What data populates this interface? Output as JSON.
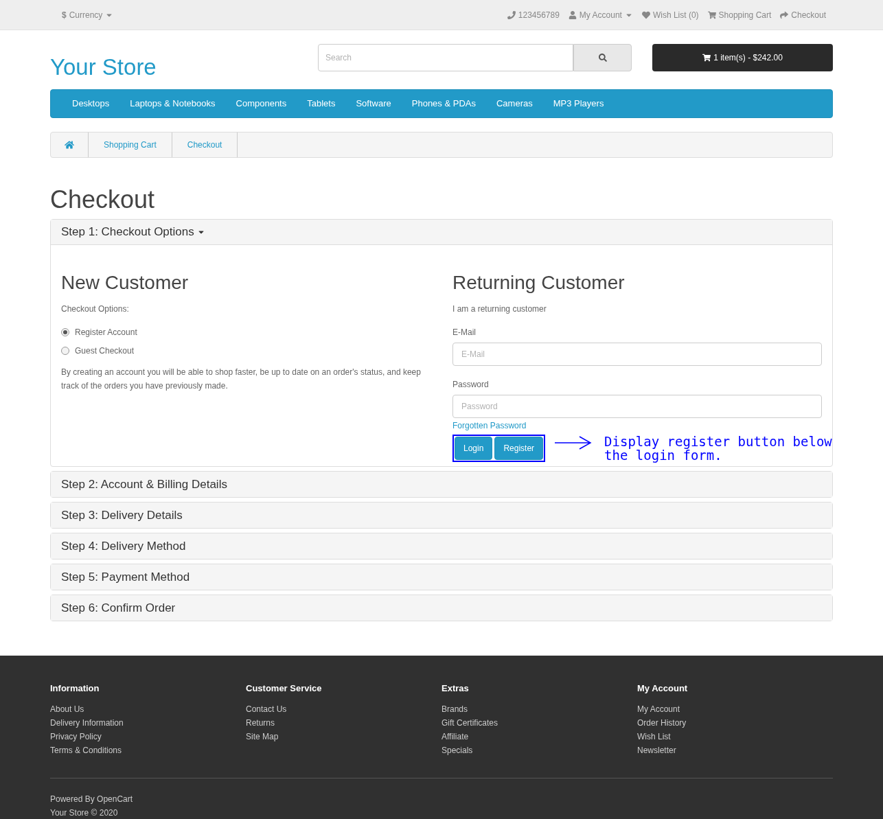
{
  "top_bar": {
    "currency": "Currency",
    "currency_symbol": "$",
    "links": [
      {
        "kind": "phone",
        "label": "123456789"
      },
      {
        "kind": "account",
        "label": "My Account",
        "dropdown": true
      },
      {
        "kind": "heart",
        "label": "Wish List (0)"
      },
      {
        "kind": "cart",
        "label": "Shopping Cart"
      },
      {
        "kind": "share",
        "label": "Checkout"
      }
    ]
  },
  "header": {
    "logo": "Your Store",
    "search": {
      "placeholder": "Search"
    },
    "cart_button": "1 item(s) - $242.00"
  },
  "menu": [
    "Desktops",
    "Laptops & Notebooks",
    "Components",
    "Tablets",
    "Software",
    "Phones & PDAs",
    "Cameras",
    "MP3 Players"
  ],
  "breadcrumb": [
    "Shopping Cart",
    "Checkout"
  ],
  "page_title": "Checkout",
  "steps": [
    {
      "title": "Step 1: Checkout Options",
      "expanded": true
    },
    {
      "title": "Step 2: Account & Billing Details",
      "expanded": false
    },
    {
      "title": "Step 3: Delivery Details",
      "expanded": false
    },
    {
      "title": "Step 4: Delivery Method",
      "expanded": false
    },
    {
      "title": "Step 5: Payment Method",
      "expanded": false
    },
    {
      "title": "Step 6: Confirm Order",
      "expanded": false
    }
  ],
  "new_customer": {
    "heading": "New Customer",
    "options_label": "Checkout Options:",
    "options": [
      {
        "label": "Register Account",
        "selected": true
      },
      {
        "label": "Guest Checkout",
        "selected": false
      }
    ],
    "description": "By creating an account you will be able to shop faster, be up to date on an order's status, and keep track of the orders you have previously made."
  },
  "returning_customer": {
    "heading": "Returning Customer",
    "subtitle": "I am a returning customer",
    "email_label": "E-Mail",
    "email": {
      "placeholder": "E-Mail"
    },
    "password_label": "Password",
    "password": {
      "placeholder": "Password"
    },
    "forgot_link": "Forgotten Password",
    "buttons": [
      "Login",
      "Register"
    ]
  },
  "annotation": "Display register button below the login form.",
  "footer": {
    "columns": [
      {
        "heading": "Information",
        "links": [
          "About Us",
          "Delivery Information",
          "Privacy Policy",
          "Terms & Conditions"
        ]
      },
      {
        "heading": "Customer Service",
        "links": [
          "Contact Us",
          "Returns",
          "Site Map"
        ]
      },
      {
        "heading": "Extras",
        "links": [
          "Brands",
          "Gift Certificates",
          "Affiliate",
          "Specials"
        ]
      },
      {
        "heading": "My Account",
        "links": [
          "My Account",
          "Order History",
          "Wish List",
          "Newsletter"
        ]
      }
    ],
    "powered_by": "Powered By",
    "powered_link": "OpenCart",
    "copyright": "Your Store © 2020"
  }
}
